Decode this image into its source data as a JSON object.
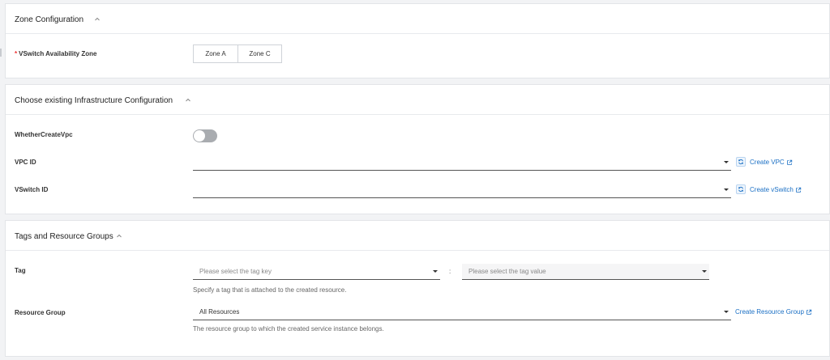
{
  "zone_section": {
    "title": "Zone Configuration",
    "vswitch_label": "VSwitch Availability Zone",
    "required_mark": "*",
    "zones": [
      "Zone A",
      "Zone C"
    ]
  },
  "infra_section": {
    "title": "Choose existing Infrastructure Configuration",
    "create_vpc_label": "WhetherCreateVpc",
    "create_vpc_enabled": false,
    "vpc_label": "VPC ID",
    "vpc_value": "",
    "vpc_link": "Create VPC",
    "vswitch_label": "VSwitch ID",
    "vswitch_value": "",
    "vswitch_link": "Create vSwitch"
  },
  "tags_section": {
    "title": "Tags and Resource Groups",
    "tag_label": "Tag",
    "tag_key_placeholder": "Please select the tag key",
    "tag_separator": ":",
    "tag_value_placeholder": "Please select the tag value",
    "tag_hint": "Specify a tag that is attached to the created resource.",
    "rg_label": "Resource Group",
    "rg_value": "All Resources",
    "rg_link": "Create Resource Group",
    "rg_hint": "The resource group to which the created service instance belongs."
  },
  "icons": {
    "collapse": "chevron-up-icon",
    "refresh": "refresh-icon",
    "external": "external-link-icon",
    "dropdown": "caret-down-icon"
  },
  "colors": {
    "link": "#1a6fc4",
    "required": "#e33333",
    "toggle_off": "#a9acb0"
  }
}
